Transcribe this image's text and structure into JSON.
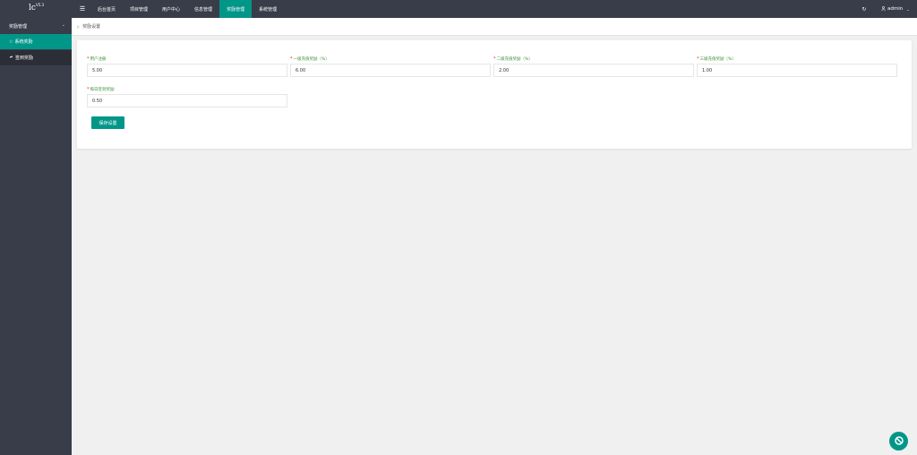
{
  "logo": {
    "text": "lc",
    "version": "V5.3"
  },
  "header": {
    "menu_toggle_icon": "☰",
    "nav": [
      "后台首页",
      "项目管理",
      "用户中心",
      "信息管理",
      "奖励管理",
      "系统管理"
    ],
    "active_nav": 4,
    "refresh_icon": "↻",
    "user": "admin",
    "user_chevron": "⌄"
  },
  "sidebar": {
    "group": "奖励管理",
    "group_chevron": "⌄",
    "items": [
      {
        "icon": "☆",
        "label": "系统奖励"
      },
      {
        "icon": "🔗",
        "label": "签到奖励"
      }
    ]
  },
  "breadcrumb": {
    "icon": "▷",
    "label": "奖励设置"
  },
  "form": {
    "fields": [
      {
        "label": "用户注册",
        "value": "5.00"
      },
      {
        "label": "一级充值奖励（%）",
        "value": "6.00"
      },
      {
        "label": "二级充值奖励（%）",
        "value": "2.00"
      },
      {
        "label": "三级充值奖励（%）",
        "value": "1.00"
      },
      {
        "label": "每日签到奖励",
        "value": "0.50"
      }
    ],
    "required_mark": "*",
    "save_label": "保存设置"
  },
  "colors": {
    "accent": "#009688",
    "header": "#393d49",
    "label": "#3c8f3c",
    "required": "#e02020"
  }
}
